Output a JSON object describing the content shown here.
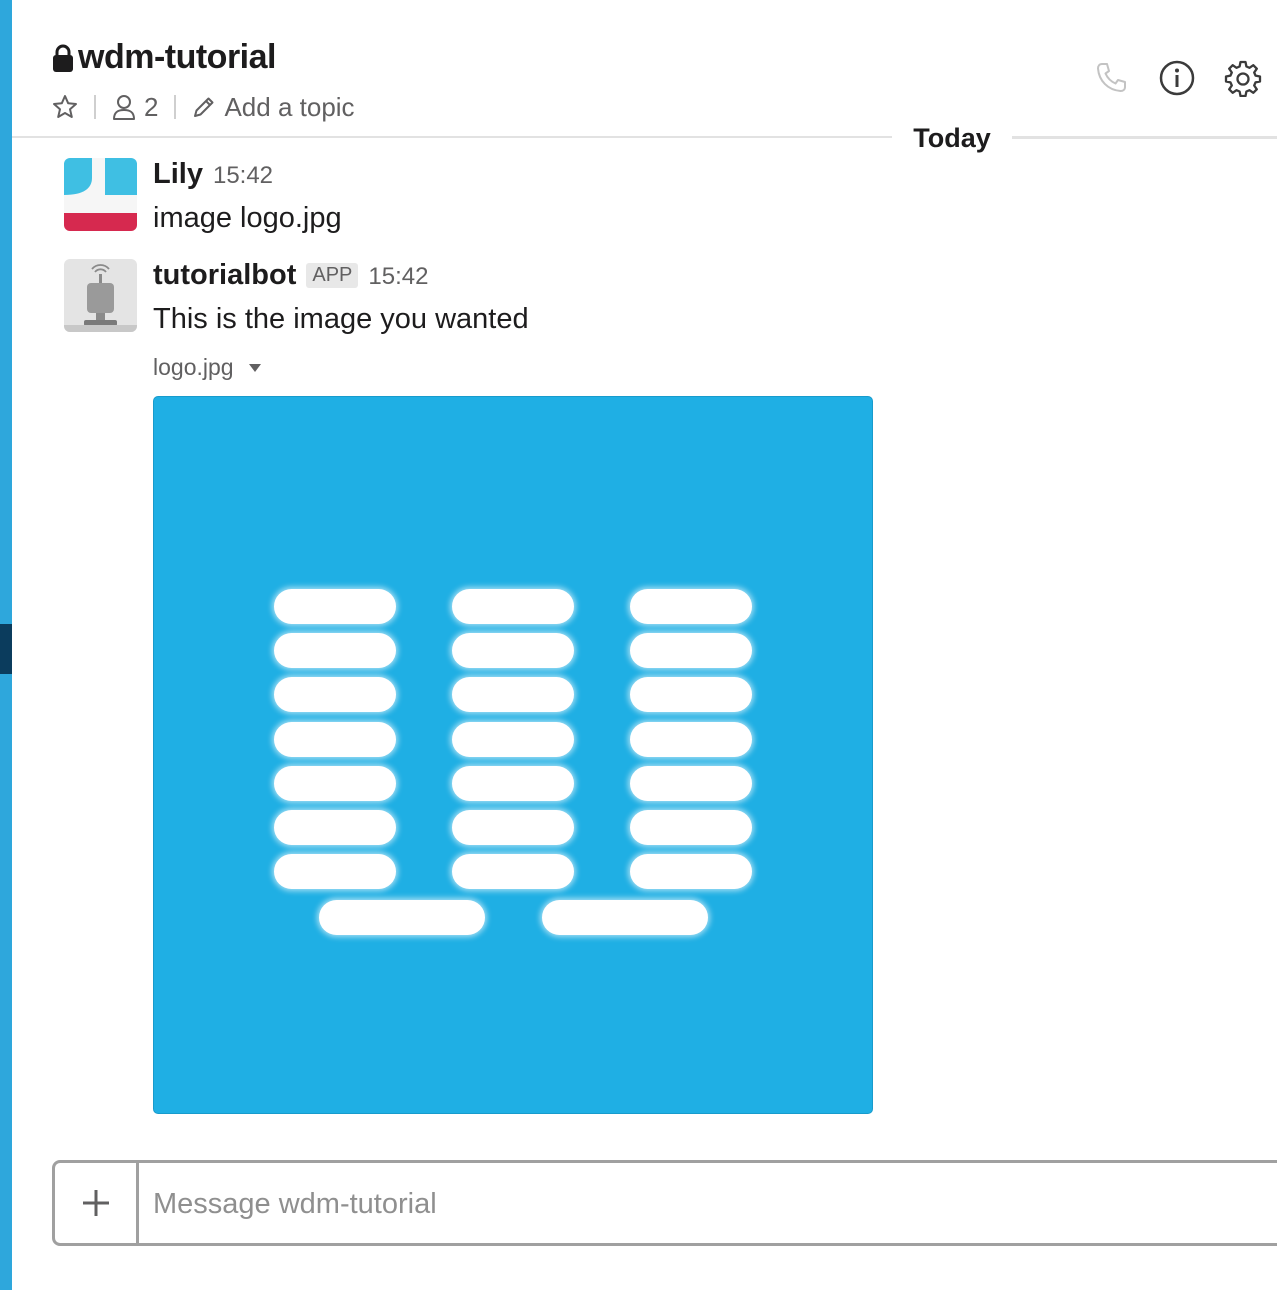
{
  "channel": {
    "name": "wdm-tutorial",
    "member_count": "2",
    "topic_placeholder": "Add a topic"
  },
  "header_actions": [
    "phone-icon",
    "info-icon",
    "gear-icon"
  ],
  "day_divider": "Today",
  "messages": [
    {
      "sender": "Lily",
      "time": "15:42",
      "text": "image logo.jpg",
      "avatar_colors": {
        "top": "#3fbfe3",
        "bottom": "#d6294f"
      }
    },
    {
      "sender": "tutorialbot",
      "badge": "APP",
      "time": "15:42",
      "text": "This is the image you wanted",
      "attachment": {
        "file_name": "logo.jpg",
        "background": "#1fafe4"
      }
    }
  ],
  "composer": {
    "placeholder": "Message wdm-tutorial"
  },
  "colors": {
    "sidebar_accent": "#2ea7dc",
    "sidebar_selected": "#0b3c5d"
  }
}
